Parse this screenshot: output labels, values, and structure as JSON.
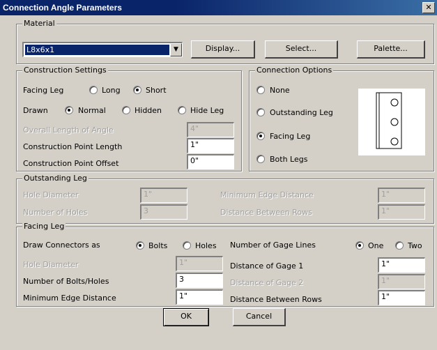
{
  "title": "Connection Angle Parameters",
  "close_label": "✕",
  "material": {
    "group_label": "Material",
    "selected": "L8x6x1",
    "display_label": "Display...",
    "select_label": "Select...",
    "palette_label": "Palette..."
  },
  "construction": {
    "group_label": "Construction Settings",
    "facing_leg_label": "Facing Leg",
    "long_label": "Long",
    "short_label": "Short",
    "drawn_label": "Drawn",
    "normal_label": "Normal",
    "hidden_label": "Hidden",
    "hide_leg_label": "Hide Leg",
    "overall_length_label": "Overall Length of Angle",
    "overall_length_value": "4\"",
    "cp_length_label": "Construction Point Length",
    "cp_length_value": "1\"",
    "cp_offset_label": "Construction Point Offset",
    "cp_offset_value": "0\""
  },
  "connection": {
    "group_label": "Connection Options",
    "none_label": "None",
    "outstanding_label": "Outstanding Leg",
    "facing_label": "Facing Leg",
    "both_label": "Both Legs"
  },
  "outstanding": {
    "group_label": "Outstanding Leg",
    "hole_diameter_label": "Hole Diameter",
    "hole_diameter_value": "1\"",
    "num_holes_label": "Number of Holes",
    "num_holes_value": "3",
    "min_edge_label": "Minimum Edge Distance",
    "min_edge_value": "1\"",
    "dist_rows_label": "Distance Between Rows",
    "dist_rows_value": "1\""
  },
  "facing": {
    "group_label": "Facing Leg",
    "draw_as_label": "Draw Connectors as",
    "bolts_label": "Bolts",
    "holes_label": "Holes",
    "gage_lines_label": "Number of Gage Lines",
    "one_label": "One",
    "two_label": "Two",
    "hole_diameter_label": "Hole Diameter",
    "hole_diameter_value": "1\"",
    "num_bolts_label": "Number of Bolts/Holes",
    "num_bolts_value": "3",
    "min_edge_label": "Minimum Edge Distance",
    "min_edge_value": "1\"",
    "gage1_label": "Distance of Gage 1",
    "gage1_value": "1\"",
    "gage2_label": "Distance of Gage 2",
    "gage2_value": "1\"",
    "dist_rows_label": "Distance Between Rows",
    "dist_rows_value": "1\""
  },
  "buttons": {
    "ok_label": "OK",
    "cancel_label": "Cancel"
  }
}
